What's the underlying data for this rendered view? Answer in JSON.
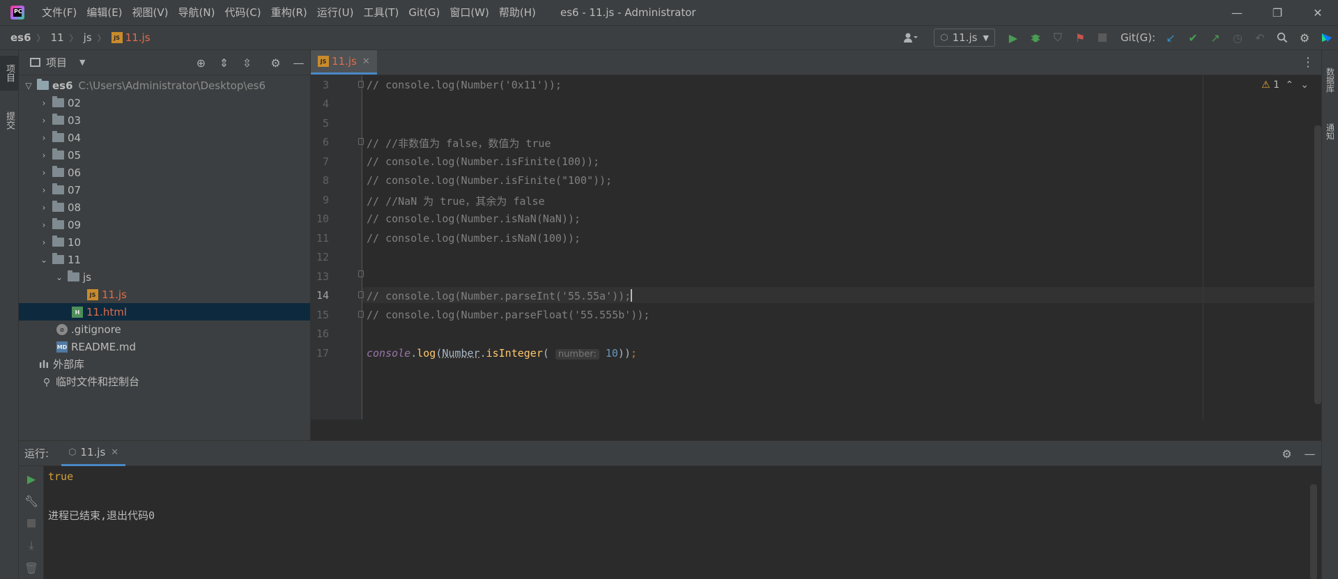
{
  "titlebar": {
    "menus": [
      "文件(F)",
      "编辑(E)",
      "视图(V)",
      "导航(N)",
      "代码(C)",
      "重构(R)",
      "运行(U)",
      "工具(T)",
      "Git(G)",
      "窗口(W)",
      "帮助(H)"
    ],
    "window_title": "es6 - 11.js - Administrator",
    "controls": [
      "minimize-icon",
      "restore-icon",
      "close-icon"
    ]
  },
  "breadcrumb": {
    "project": "es6",
    "folder1": "11",
    "folder2": "js",
    "file": "11.js"
  },
  "navbar": {
    "run_config": "11.js",
    "git_label": "Git(G):"
  },
  "left_strip": {
    "project_tab": "项目",
    "commit_tab": "提交"
  },
  "right_strip": {
    "database_tab": "数据库",
    "notifications_tab": "通知"
  },
  "project_panel": {
    "title": "项目",
    "root_name": "es6",
    "root_path": "C:\\Users\\Administrator\\Desktop\\es6",
    "folders": [
      "02",
      "03",
      "04",
      "05",
      "06",
      "07",
      "08",
      "09",
      "10"
    ],
    "open_folder": "11",
    "sub_folder": "js",
    "js_file": "11.js",
    "html_file": "11.html",
    "gitignore": ".gitignore",
    "readme": "README.md",
    "external_libs": "外部库",
    "scratches": "临时文件和控制台"
  },
  "editor": {
    "tab": "11.js",
    "warning_count": "1",
    "lines": [
      {
        "n": "3",
        "text": "// console.log(Number('0x11'));"
      },
      {
        "n": "4",
        "text": ""
      },
      {
        "n": "5",
        "text": ""
      },
      {
        "n": "6",
        "text": "// //非数值为 false，数值为 true"
      },
      {
        "n": "7",
        "text": "// console.log(Number.isFinite(100));"
      },
      {
        "n": "8",
        "text": "// console.log(Number.isFinite(\"100\"));"
      },
      {
        "n": "9",
        "text": "// //NaN 为 true，其余为 false"
      },
      {
        "n": "10",
        "text": "// console.log(Number.isNaN(NaN));"
      },
      {
        "n": "11",
        "text": "// console.log(Number.isNaN(100));"
      },
      {
        "n": "12",
        "text": ""
      },
      {
        "n": "13",
        "text": ""
      },
      {
        "n": "14",
        "text": "// console.log(Number.parseInt('55.55a'));"
      },
      {
        "n": "15",
        "text": "// console.log(Number.parseFloat('55.555b'));"
      },
      {
        "n": "16",
        "text": ""
      },
      {
        "n": "17",
        "text": ""
      }
    ],
    "code17": {
      "obj": "console",
      "dot1": ".",
      "log": "log",
      "paren1": "(",
      "cls": "Number",
      "dot2": ".",
      "method": "isInteger",
      "paren2": "(",
      "hint": "number:",
      "arg": "10",
      "close": "))",
      "semi": ";"
    }
  },
  "run_panel": {
    "label": "运行:",
    "tab": "11.js",
    "output_true": "true",
    "output_exit": "进程已结束,退出代码0"
  }
}
